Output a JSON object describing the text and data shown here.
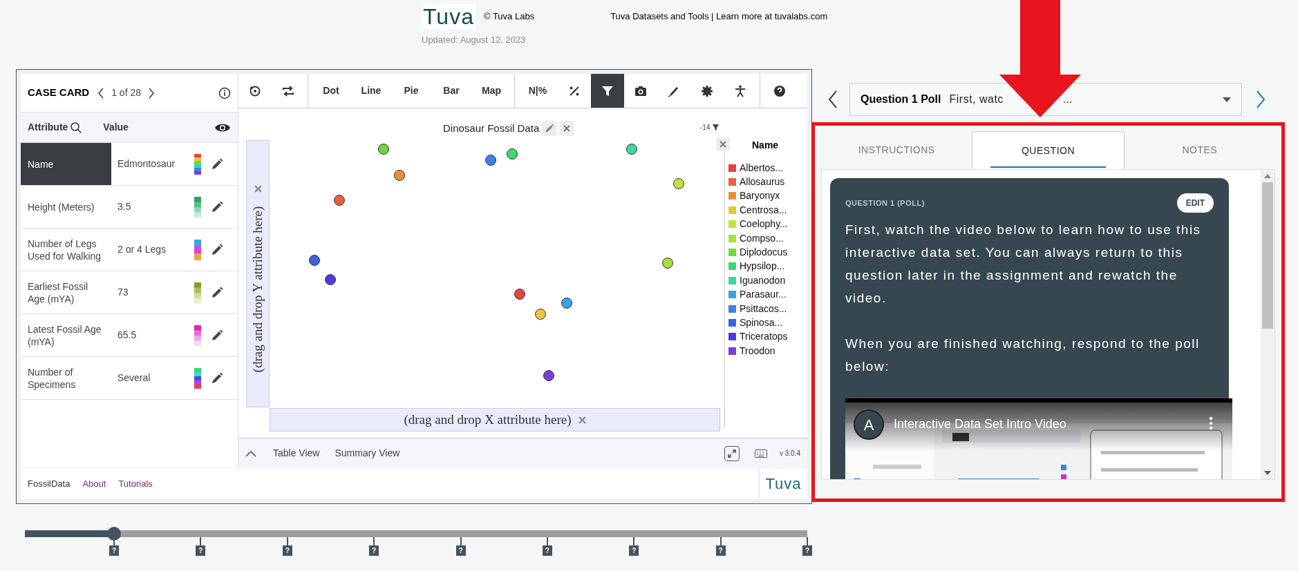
{
  "header": {
    "logo": "Tuva",
    "copyright": "© Tuva Labs",
    "links_text": "Tuva Datasets and Tools | Learn more at tuvalabs.com",
    "updated": "Updated: August 12, 2023"
  },
  "case_card": {
    "title": "CASE CARD",
    "position": "1 of 28",
    "columns": [
      "Attribute",
      "Value"
    ],
    "rows": [
      {
        "attribute": "Name",
        "value": "Edmontosaur",
        "selected": true
      },
      {
        "attribute": "Height (Meters)",
        "value": "3.5",
        "selected": false
      },
      {
        "attribute": "Number of Legs Used for Walking",
        "value": "2 or 4 Legs",
        "selected": false
      },
      {
        "attribute": "Earliest Fossil Age (mYA)",
        "value": "73",
        "selected": false
      },
      {
        "attribute": "Latest Fossil Age (mYA)",
        "value": "65.5",
        "selected": false
      },
      {
        "attribute": "Number of Specimens",
        "value": "Several",
        "selected": false
      }
    ]
  },
  "footer_links": [
    {
      "label": "FossilData",
      "kind": "plain"
    },
    {
      "label": "About",
      "kind": "link"
    },
    {
      "label": "Tutorials",
      "kind": "link"
    }
  ],
  "toolbar": [
    {
      "kind": "icon",
      "selected": false
    },
    {
      "kind": "icon",
      "selected": false
    },
    {
      "kind": "divider"
    },
    {
      "kind": "text",
      "label": "Dot",
      "selected": false
    },
    {
      "kind": "text",
      "label": "Line",
      "selected": false
    },
    {
      "kind": "text",
      "label": "Pie",
      "selected": false
    },
    {
      "kind": "text",
      "label": "Bar",
      "selected": false
    },
    {
      "kind": "text",
      "label": "Map",
      "selected": false
    },
    {
      "kind": "divider"
    },
    {
      "kind": "text",
      "label": "N|%",
      "selected": false
    },
    {
      "kind": "icon",
      "selected": false
    },
    {
      "kind": "icon",
      "selected": true
    },
    {
      "kind": "icon",
      "selected": false
    },
    {
      "kind": "icon",
      "selected": false
    },
    {
      "kind": "icon",
      "selected": false
    },
    {
      "kind": "icon",
      "selected": false
    },
    {
      "kind": "divider"
    },
    {
      "kind": "icon",
      "selected": false
    }
  ],
  "chart": {
    "title": "Dinosaur Fossil Data",
    "filter_count": "-14",
    "y_drop": "(drag and drop Y attribute here)",
    "x_drop": "(drag and drop X attribute here)",
    "legend": {
      "title": "Name",
      "items": [
        {
          "label": "Albertos...",
          "color": "#e84343"
        },
        {
          "label": "Allosaurus",
          "color": "#e8603c"
        },
        {
          "label": "Baryonyx",
          "color": "#e8913c"
        },
        {
          "label": "Centrosa...",
          "color": "#e8c63c"
        },
        {
          "label": "Coelophy...",
          "color": "#c6e03c"
        },
        {
          "label": "Compso...",
          "color": "#a6e03c"
        },
        {
          "label": "Diplodocus",
          "color": "#6cd83c"
        },
        {
          "label": "Hypsilop...",
          "color": "#3cd874"
        },
        {
          "label": "Iguanodon",
          "color": "#3cd8a2"
        },
        {
          "label": "Parasaur...",
          "color": "#3ca2e8"
        },
        {
          "label": "Psittacos...",
          "color": "#3c82e8"
        },
        {
          "label": "Spinosa...",
          "color": "#3c62e0"
        },
        {
          "label": "Triceratops",
          "color": "#4c3ce0"
        },
        {
          "label": "Troodon",
          "color": "#7a3ce0"
        }
      ]
    }
  },
  "bottom_bar": {
    "tabs": [
      "Table View",
      "Summary View"
    ],
    "version": "v 3.0.4"
  },
  "footer_logo": "Tuva",
  "question_nav": {
    "label": "Question 1 Poll",
    "summary": "First, watc",
    "summary_end": "..."
  },
  "tabs": [
    {
      "label": "INSTRUCTIONS",
      "selected": false
    },
    {
      "label": "QUESTION",
      "selected": true
    },
    {
      "label": "NOTES",
      "selected": false
    }
  ],
  "question": {
    "heading": "QUESTION 1 (POLL)",
    "edit": "EDIT",
    "paragraphs": [
      "First, watch the video below to learn how to use this interactive data set. You can always return to this question later in the assignment and rewatch the video.",
      "When you are finished watching, respond to the poll below:"
    ],
    "video": {
      "avatar": "A",
      "title": "Interactive Data Set Intro Video"
    }
  },
  "timeline": {
    "level": 0.114,
    "markers": [
      "?",
      "?",
      "?",
      "?",
      "?",
      "?",
      "?",
      "?",
      "?"
    ]
  }
}
